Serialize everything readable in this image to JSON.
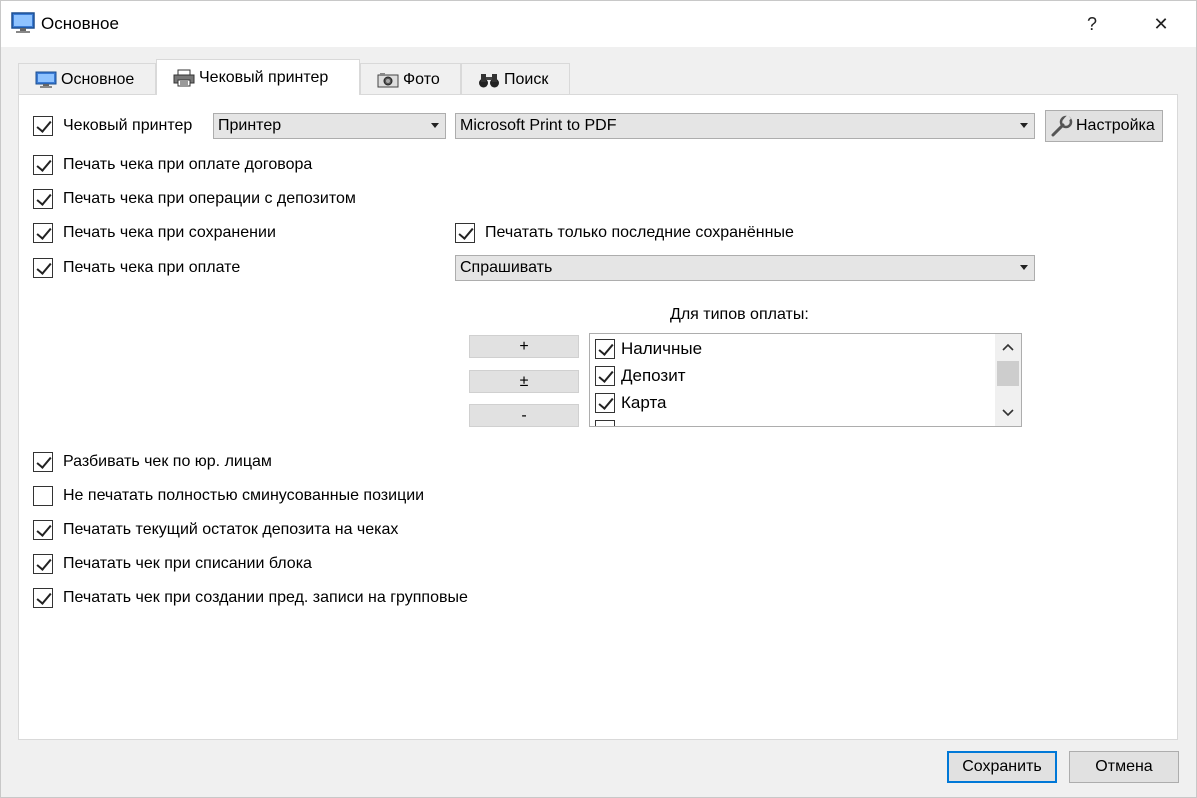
{
  "window": {
    "title": "Основное",
    "help_glyph": "?",
    "close_glyph": "✕"
  },
  "tabs": [
    {
      "label": "Основное",
      "icon": "monitor-icon"
    },
    {
      "label": "Чековый принтер",
      "icon": "printer-icon",
      "active": true
    },
    {
      "label": "Фото",
      "icon": "camera-icon"
    },
    {
      "label": "Поиск",
      "icon": "binoculars-icon"
    }
  ],
  "printer": {
    "checkbox_label": "Чековый принтер",
    "checked": true,
    "type_value": "Принтер",
    "device_value": "Microsoft Print to PDF",
    "setup_label": "Настройка"
  },
  "options": {
    "contract_pay": {
      "label": "Печать чека при оплате договора",
      "checked": true
    },
    "deposit_op": {
      "label": "Печать чека при операции с депозитом",
      "checked": true
    },
    "on_save": {
      "label": "Печать чека при сохранении",
      "checked": true
    },
    "only_last_saved": {
      "label": "Печатать только последние сохранённые",
      "checked": true
    },
    "on_pay": {
      "label": "Печать чека при оплате",
      "checked": true
    },
    "on_pay_mode": "Спрашивать"
  },
  "payment_types": {
    "title": "Для типов оплаты:",
    "buttons": {
      "add": "+",
      "toggle": "±",
      "remove": "-"
    },
    "items": [
      {
        "label": "Наличные",
        "checked": true
      },
      {
        "label": "Депозит",
        "checked": true
      },
      {
        "label": "Карта",
        "checked": true
      }
    ]
  },
  "extra": {
    "split_legal": {
      "label": "Разбивать чек по юр. лицам",
      "checked": true
    },
    "no_print_minus": {
      "label": "Не печатать полностью сминусованные позиции",
      "checked": false
    },
    "deposit_balance": {
      "label": "Печатать текущий остаток депозита на чеках",
      "checked": true
    },
    "block_writeoff": {
      "label": "Печатать чек при списании блока",
      "checked": true
    },
    "group_prebook": {
      "label": "Печатать чек при создании пред. записи на групповые",
      "checked": true
    }
  },
  "footer": {
    "save_label": "Сохранить",
    "cancel_label": "Отмена"
  },
  "colors": {
    "accent": "#0078d7",
    "panel_bg": "#ffffff",
    "window_bg": "#f0f0f0"
  }
}
